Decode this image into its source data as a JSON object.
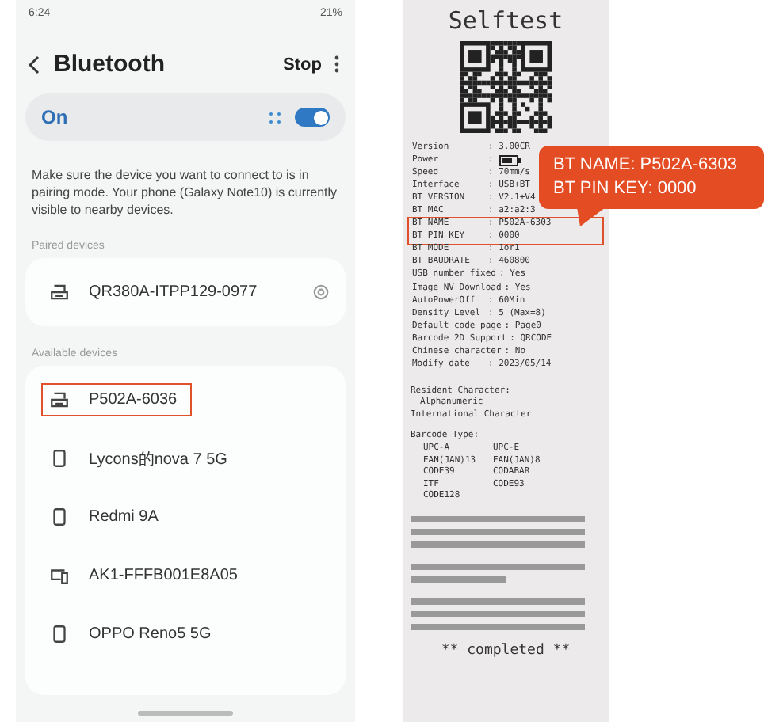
{
  "phone": {
    "status_bar": {
      "time": "6:24",
      "battery": "21%"
    },
    "header": {
      "title": "Bluetooth",
      "action": "Stop"
    },
    "bluetooth": {
      "label": "On",
      "on": true
    },
    "description": "Make sure the device you want to connect to is in pairing mode. Your phone (Galaxy Note10) is currently visible to nearby devices.",
    "paired": {
      "title": "Paired devices",
      "devices": [
        {
          "name": "QR380A-ITPP129-0977",
          "kind": "printer",
          "highlighted": false
        }
      ]
    },
    "available": {
      "title": "Available devices",
      "devices": [
        {
          "name": "P502A-6036",
          "kind": "printer",
          "highlighted": true
        },
        {
          "name": "Lycons的nova 7 5G",
          "kind": "phone",
          "highlighted": false
        },
        {
          "name": "Redmi 9A",
          "kind": "phone",
          "highlighted": false
        },
        {
          "name": "AK1-FFFB001E8A05",
          "kind": "devices",
          "highlighted": false
        },
        {
          "name": "OPPO Reno5 5G",
          "kind": "phone",
          "highlighted": false
        }
      ]
    }
  },
  "receipt": {
    "title": "Selftest",
    "rows": [
      {
        "label": "Version",
        "value": ": 3.00CR",
        "highlighted": false
      },
      {
        "label": "Power",
        "value": ":",
        "kind": "battery",
        "highlighted": false
      },
      {
        "label": "Speed",
        "value": ": 70mm/s",
        "highlighted": false
      },
      {
        "label": "Interface",
        "value": ": USB+BT",
        "highlighted": false
      },
      {
        "label": "BT VERSION",
        "value": ": V2.1+V4",
        "highlighted": false
      },
      {
        "label": "BT MAC",
        "value": ": a2:a2:3",
        "highlighted": false
      },
      {
        "label": "BT NAME",
        "value": ": P502A-6303",
        "highlighted": true
      },
      {
        "label": "BT PIN KEY",
        "value": ": 0000",
        "highlighted": true
      },
      {
        "label": "BT MODE",
        "value": ": 1or1",
        "highlighted": false
      },
      {
        "label": "BT BAUDRATE",
        "value": ": 460800",
        "highlighted": false
      },
      {
        "label": "USB number fixed",
        "value": ": Yes",
        "highlighted": false
      },
      {
        "label": "Image NV Download",
        "value": ": Yes",
        "highlighted": false
      },
      {
        "label": "AutoPowerOff",
        "value": ": 60Min",
        "highlighted": false
      },
      {
        "label": "Density Level",
        "value": ": 5 (Max=8)",
        "highlighted": false
      },
      {
        "label": "Default code page",
        "value": ": Page0",
        "highlighted": false
      },
      {
        "label": "Barcode 2D Support",
        "value": ": QRCODE",
        "highlighted": false
      },
      {
        "label": "Chinese character",
        "value": ": No",
        "highlighted": false
      },
      {
        "label": "Modify date",
        "value": ": 2023/05/14",
        "highlighted": false
      }
    ],
    "resident": [
      "Resident Character:",
      "Alphanumeric",
      "International Character"
    ],
    "barcode_title": "Barcode Type:",
    "barcodes": [
      "UPC-A",
      "UPC-E",
      "EAN(JAN)13",
      "EAN(JAN)8",
      "CODE39",
      "CODABAR",
      "ITF",
      "CODE93",
      "CODE128"
    ],
    "footer": "** completed **"
  },
  "callout": [
    "BT NAME: P502A-6303",
    "BT PIN KEY: 0000"
  ]
}
